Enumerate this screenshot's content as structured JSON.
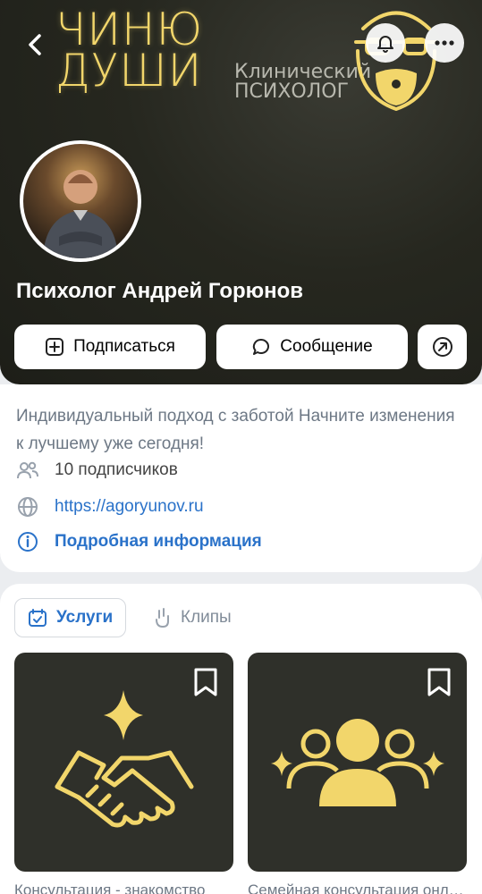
{
  "cover": {
    "logo_line1": "ЧИНЮ",
    "logo_line2": "ДУШИ",
    "logo_sub1": "Клинический",
    "logo_sub2": "ПСИХОЛОГ",
    "accent_color": "#f2d66b"
  },
  "header": {
    "back_icon": "chevron-left-icon",
    "bell_icon": "bell-icon",
    "more_icon": "more-horizontal-icon"
  },
  "profile": {
    "name": "Психолог Андрей Горюнов",
    "actions": {
      "subscribe_label": "Подписаться",
      "message_label": "Сообщение"
    }
  },
  "info": {
    "bio": "Индивидуальный подход с заботой  Начните изменения к лучшему уже сегодня!",
    "followers": "10 подписчиков",
    "site": "https://agoryunov.ru",
    "details": "Подробная информация",
    "link_color": "#2a72c9"
  },
  "tabs": [
    {
      "label": "Услуги",
      "active": true
    },
    {
      "label": "Клипы",
      "active": false
    }
  ],
  "services": [
    {
      "title": "Консультация - знакомство",
      "icon": "handshake-icon"
    },
    {
      "title": "Семейная консультация онлайн",
      "icon": "family-group-icon"
    }
  ]
}
